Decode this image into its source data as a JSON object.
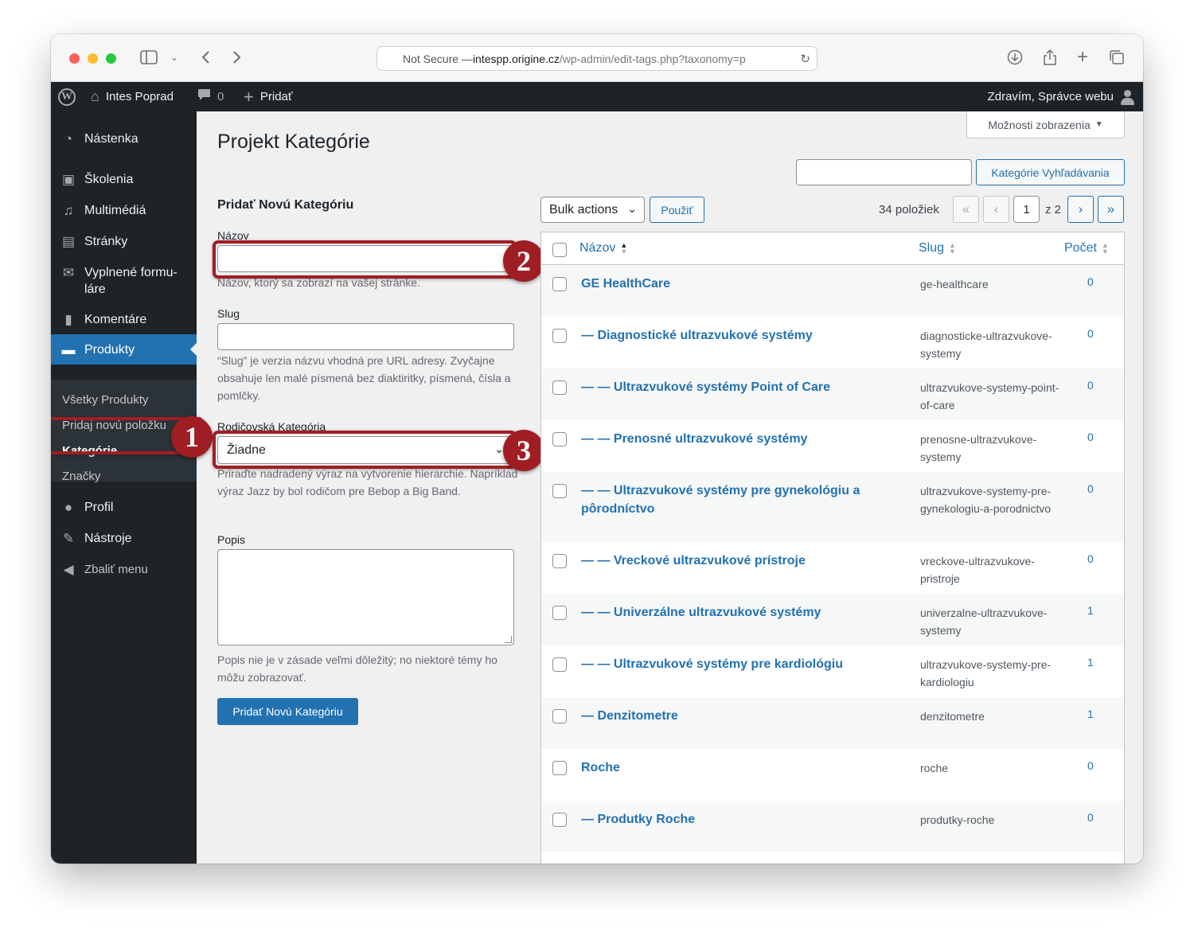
{
  "browser": {
    "url_prefix": "Not Secure — ",
    "url_host": "intespp.origine.cz",
    "url_path": "/wp-admin/edit-tags.php?taxonomy=p"
  },
  "adminbar": {
    "site_name": "Intes Poprad",
    "comments_count": "0",
    "new_label": "Pridať",
    "greeting": "Zdravím, Správce webu"
  },
  "sidebar": {
    "items": [
      {
        "label": "Nástenka",
        "icon": "dashboard-icon"
      },
      {
        "label": "Školenia",
        "icon": "training-icon"
      },
      {
        "label": "Multimédiá",
        "icon": "media-icon"
      },
      {
        "label": "Stránky",
        "icon": "pages-icon"
      },
      {
        "label": "Vyplnené formu-",
        "label2": "láre",
        "icon": "envelope-icon"
      },
      {
        "label": "Komentáre",
        "icon": "comment-icon"
      },
      {
        "label": "Produkty",
        "icon": "folder-icon"
      },
      {
        "label": "Profil",
        "icon": "user-icon"
      },
      {
        "label": "Nástroje",
        "icon": "wrench-icon"
      },
      {
        "label": "Zbaliť menu",
        "icon": "collapse-icon"
      }
    ],
    "submenu": [
      "Všetky Produkty",
      "Pridaj novú položku",
      "Kategórie",
      "Značky"
    ]
  },
  "header": {
    "title": "Projekt Kategórie",
    "screen_options": "Možnosti zobrazenia",
    "search_button": "Kategórie Vyhľadávania"
  },
  "form": {
    "heading": "Pridať Novú Kategóriu",
    "name_label": "Názov",
    "name_help": "Názov, ktorý sa zobrazí na vašej stránke.",
    "slug_label": "Slug",
    "slug_help": "“Slug” je verzia názvu vhodná pre URL adresy. Zvyčajne obsahuje len malé písmená bez diaktiritky, písmená, čísla a pomlčky.",
    "parent_label": "Rodičovská Kategória",
    "parent_value": "Žiadne",
    "parent_help": "Priraďte nadradený výraz na vytvorenie hierarchie. Napríklad výraz Jazz by bol rodičom pre Bebop a Big Band.",
    "desc_label": "Popis",
    "desc_help": "Popis nie je v zásade veľmi dôležitý; no niektoré témy ho môžu zobrazovať.",
    "submit": "Pridať Novú Kategóriu"
  },
  "annotations": [
    "1",
    "2",
    "3"
  ],
  "table_tools": {
    "bulk_actions": "Bulk actions",
    "apply": "Použiť",
    "items_count": "34 položiek",
    "first": "«",
    "prev": "‹",
    "current_page": "1",
    "of_pages": "z 2",
    "next": "›",
    "last": "»"
  },
  "table": {
    "columns": {
      "name": "Názov",
      "slug": "Slug",
      "count": "Počet"
    },
    "rows": [
      {
        "name": "GE HealthCare",
        "slug": "ge-healthcare",
        "count": "0"
      },
      {
        "name": "— Diagnostické ultrazvukové systémy",
        "slug": "diagnosticke-ultrazvukove-systemy",
        "count": "0"
      },
      {
        "name": "— — Ultrazvukové systémy Point of Care",
        "slug": "ultrazvukove-systemy-point-of-care",
        "count": "0"
      },
      {
        "name": "— — Prenosné ultrazvukové systémy",
        "slug": "prenosne-ultrazvukove-systemy",
        "count": "0"
      },
      {
        "name": "— — Ultrazvukové systémy pre gynekológiu a pôrodníctvo",
        "slug": "ultrazvukove-systemy-pre-gynekologiu-a-porodnictvo",
        "count": "0"
      },
      {
        "name": "— — Vreckové ultrazvukové prístroje",
        "slug": "vreckove-ultrazvukove-pristroje",
        "count": "0"
      },
      {
        "name": "— — Univerzálne ultrazvukové systémy",
        "slug": "univerzalne-ultrazvukove-systemy",
        "count": "1"
      },
      {
        "name": "— — Ultrazvukové systémy pre kardiológiu",
        "slug": "ultrazvukove-systemy-pre-kardiologiu",
        "count": "1"
      },
      {
        "name": "— Denzitometre",
        "slug": "denzitometre",
        "count": "1"
      },
      {
        "name": "Roche",
        "slug": "roche",
        "count": "0"
      },
      {
        "name": "— Produtky Roche",
        "slug": "produtky-roche",
        "count": "0"
      }
    ]
  },
  "colors": {
    "accent": "#2271b1",
    "adminbar": "#1d2327",
    "annotation": "#a11d24"
  }
}
